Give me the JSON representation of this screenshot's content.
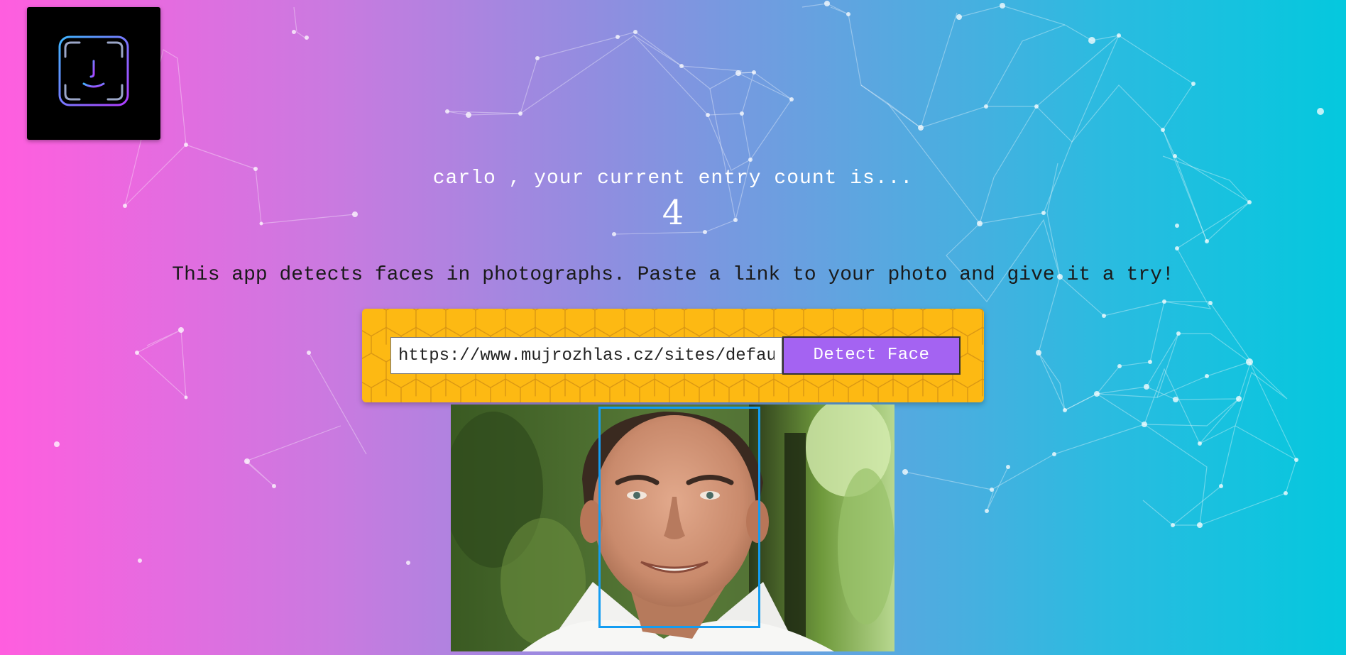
{
  "app": {
    "logo_icon": "face-id-icon"
  },
  "header": {
    "greeting": "carlo , your current entry count is...",
    "entry_count": "4"
  },
  "intro": {
    "description": "This app detects faces in photographs. Paste a link to your photo and give it a try!"
  },
  "form": {
    "url_value": "https://www.mujrozhlas.cz/sites/default/files/styles/zpravy_fotogalerie_large/public/gott.jpg",
    "detect_label": "Detect Face"
  },
  "colors": {
    "panel": "#fdb913",
    "button": "#a463f2",
    "face_box": "#149df2"
  }
}
